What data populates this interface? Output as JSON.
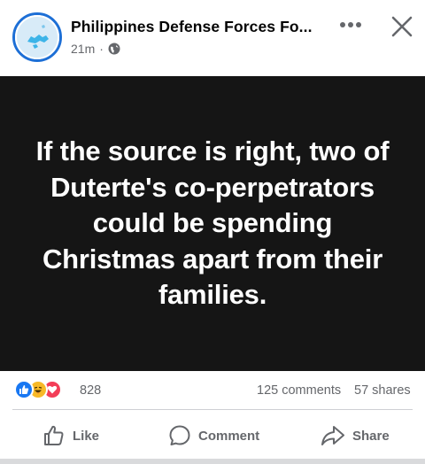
{
  "post": {
    "page_name": "Philippines Defense Forces Fo...",
    "time": "21m",
    "separator": "·",
    "privacy_icon": "globe-icon",
    "image_text": "If the source is right, two of Duterte's co-perpetrators could be spending Christmas apart from their families."
  },
  "header_actions": {
    "more_icon": "more-icon",
    "close_icon": "close-icon"
  },
  "stats": {
    "reactions": [
      "like",
      "haha",
      "love"
    ],
    "reaction_count": "828",
    "comments": "125 comments",
    "shares": "57 shares"
  },
  "actions": {
    "like_label": "Like",
    "comment_label": "Comment",
    "share_label": "Share"
  },
  "colors": {
    "like_blue": "#1877f2",
    "haha_yellow": "#f7b928",
    "love_red": "#f33e58",
    "image_background": "#151515",
    "secondary_text": "#65676b"
  }
}
